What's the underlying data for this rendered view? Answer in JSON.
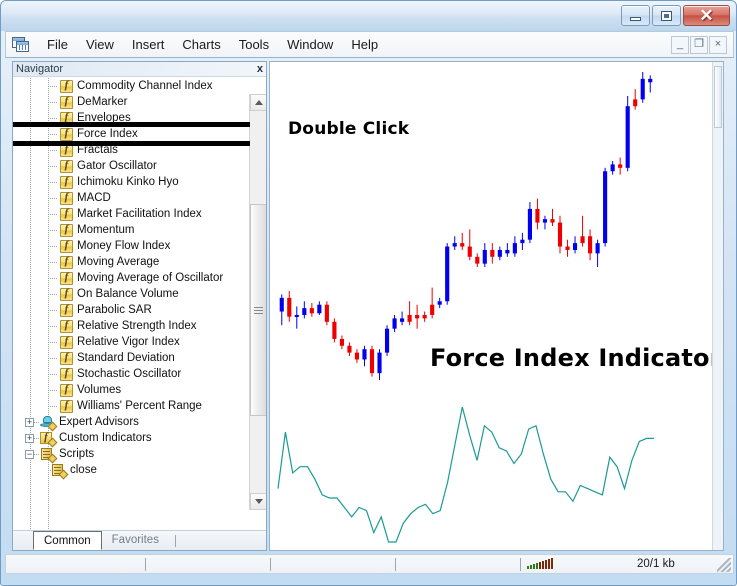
{
  "window": {
    "title": "",
    "buttons": {
      "minimize": "minimize-icon",
      "maximize": "maximize-icon",
      "close": "✕"
    }
  },
  "menu": {
    "app_icon": "metatrader-icon",
    "items": [
      "File",
      "View",
      "Insert",
      "Charts",
      "Tools",
      "Window",
      "Help"
    ],
    "mdi_buttons": [
      "_",
      "❐",
      "×"
    ]
  },
  "navigator": {
    "title": "Navigator",
    "close_label": "x",
    "tree": [
      {
        "label": "Commodity Channel Index",
        "icon": "indicator-f-icon",
        "level": 3,
        "type": "leaf"
      },
      {
        "label": "DeMarker",
        "icon": "indicator-f-icon",
        "level": 3,
        "type": "leaf"
      },
      {
        "label": "Envelopes",
        "icon": "indicator-f-icon",
        "level": 3,
        "type": "leaf"
      },
      {
        "label": "Force Index",
        "icon": "indicator-f-icon",
        "level": 3,
        "type": "leaf",
        "selected": true
      },
      {
        "label": "Fractals",
        "icon": "indicator-f-icon",
        "level": 3,
        "type": "leaf"
      },
      {
        "label": "Gator Oscillator",
        "icon": "indicator-f-icon",
        "level": 3,
        "type": "leaf"
      },
      {
        "label": "Ichimoku Kinko Hyo",
        "icon": "indicator-f-icon",
        "level": 3,
        "type": "leaf"
      },
      {
        "label": "MACD",
        "icon": "indicator-f-icon",
        "level": 3,
        "type": "leaf"
      },
      {
        "label": "Market Facilitation Index",
        "icon": "indicator-f-icon",
        "level": 3,
        "type": "leaf"
      },
      {
        "label": "Momentum",
        "icon": "indicator-f-icon",
        "level": 3,
        "type": "leaf"
      },
      {
        "label": "Money Flow Index",
        "icon": "indicator-f-icon",
        "level": 3,
        "type": "leaf"
      },
      {
        "label": "Moving Average",
        "icon": "indicator-f-icon",
        "level": 3,
        "type": "leaf"
      },
      {
        "label": "Moving Average of Oscillator",
        "icon": "indicator-f-icon",
        "level": 3,
        "type": "leaf"
      },
      {
        "label": "On Balance Volume",
        "icon": "indicator-f-icon",
        "level": 3,
        "type": "leaf"
      },
      {
        "label": "Parabolic SAR",
        "icon": "indicator-f-icon",
        "level": 3,
        "type": "leaf"
      },
      {
        "label": "Relative Strength Index",
        "icon": "indicator-f-icon",
        "level": 3,
        "type": "leaf"
      },
      {
        "label": "Relative Vigor Index",
        "icon": "indicator-f-icon",
        "level": 3,
        "type": "leaf"
      },
      {
        "label": "Standard Deviation",
        "icon": "indicator-f-icon",
        "level": 3,
        "type": "leaf"
      },
      {
        "label": "Stochastic Oscillator",
        "icon": "indicator-f-icon",
        "level": 3,
        "type": "leaf"
      },
      {
        "label": "Volumes",
        "icon": "indicator-f-icon",
        "level": 3,
        "type": "leaf"
      },
      {
        "label": "Williams' Percent Range",
        "icon": "indicator-f-icon",
        "level": 3,
        "type": "leaf"
      },
      {
        "label": "Expert Advisors",
        "icon": "expert-advisor-icon",
        "level": 1,
        "type": "group",
        "expander": "+"
      },
      {
        "label": "Custom Indicators",
        "icon": "custom-indicator-icon",
        "level": 1,
        "type": "group",
        "expander": "+"
      },
      {
        "label": "Scripts",
        "icon": "script-icon",
        "level": 1,
        "type": "group",
        "expander": "−"
      },
      {
        "label": "close",
        "icon": "script-icon",
        "level": 2,
        "type": "leaf"
      }
    ],
    "tabs": [
      {
        "label": "Common",
        "active": true
      },
      {
        "label": "Favorites",
        "active": false
      }
    ],
    "scrollbar": {
      "up_icon": "scroll-up-arrow-icon",
      "down_icon": "scroll-down-arrow-icon",
      "thumb_icon": "scroll-thumb-grip-icon"
    }
  },
  "chart": {
    "annotations": [
      {
        "id": "double-click",
        "text": "Double Click"
      },
      {
        "id": "force-index-indicator",
        "text": "Force Index Indicator"
      }
    ],
    "colors": {
      "bull_candle": "#0000ee",
      "bear_candle": "#ee0000",
      "indicator_line": "#1a9a96"
    }
  },
  "status_bar": {
    "signal_icon": "signal-strength-icon",
    "traffic": "20/1 kb",
    "resize_grip": "resize-grip-icon"
  },
  "chart_data": {
    "type": "line",
    "title": "Force Index Indicator",
    "xlabel": "",
    "ylabel": "",
    "panes": [
      {
        "name": "price",
        "type": "candlestick",
        "candles": [
          {
            "o": 52,
            "h": 62,
            "l": 44,
            "c": 60,
            "dir": "up"
          },
          {
            "o": 60,
            "h": 64,
            "l": 46,
            "c": 49,
            "dir": "down"
          },
          {
            "o": 49,
            "h": 55,
            "l": 42,
            "c": 50,
            "dir": "up"
          },
          {
            "o": 50,
            "h": 58,
            "l": 48,
            "c": 54,
            "dir": "up"
          },
          {
            "o": 54,
            "h": 57,
            "l": 49,
            "c": 51,
            "dir": "down"
          },
          {
            "o": 51,
            "h": 58,
            "l": 50,
            "c": 56,
            "dir": "up"
          },
          {
            "o": 56,
            "h": 58,
            "l": 44,
            "c": 46,
            "dir": "down"
          },
          {
            "o": 46,
            "h": 48,
            "l": 34,
            "c": 36,
            "dir": "down"
          },
          {
            "o": 36,
            "h": 38,
            "l": 30,
            "c": 32,
            "dir": "down"
          },
          {
            "o": 32,
            "h": 34,
            "l": 26,
            "c": 28,
            "dir": "down"
          },
          {
            "o": 28,
            "h": 30,
            "l": 22,
            "c": 24,
            "dir": "down"
          },
          {
            "o": 24,
            "h": 32,
            "l": 20,
            "c": 30,
            "dir": "up"
          },
          {
            "o": 30,
            "h": 32,
            "l": 14,
            "c": 16,
            "dir": "down"
          },
          {
            "o": 16,
            "h": 30,
            "l": 12,
            "c": 28,
            "dir": "up"
          },
          {
            "o": 28,
            "h": 44,
            "l": 26,
            "c": 42,
            "dir": "up"
          },
          {
            "o": 42,
            "h": 50,
            "l": 40,
            "c": 48,
            "dir": "up"
          },
          {
            "o": 48,
            "h": 52,
            "l": 44,
            "c": 46,
            "dir": "up"
          },
          {
            "o": 46,
            "h": 58,
            "l": 44,
            "c": 50,
            "dir": "down"
          },
          {
            "o": 50,
            "h": 56,
            "l": 42,
            "c": 48,
            "dir": "down"
          },
          {
            "o": 48,
            "h": 52,
            "l": 46,
            "c": 50,
            "dir": "down"
          },
          {
            "o": 50,
            "h": 66,
            "l": 48,
            "c": 56,
            "dir": "down"
          },
          {
            "o": 56,
            "h": 60,
            "l": 54,
            "c": 58,
            "dir": "up"
          },
          {
            "o": 58,
            "h": 92,
            "l": 56,
            "c": 90,
            "dir": "up"
          },
          {
            "o": 90,
            "h": 96,
            "l": 88,
            "c": 92,
            "dir": "up"
          },
          {
            "o": 92,
            "h": 98,
            "l": 88,
            "c": 90,
            "dir": "down"
          },
          {
            "o": 90,
            "h": 100,
            "l": 82,
            "c": 84,
            "dir": "down"
          },
          {
            "o": 84,
            "h": 86,
            "l": 78,
            "c": 80,
            "dir": "down"
          },
          {
            "o": 80,
            "h": 92,
            "l": 78,
            "c": 88,
            "dir": "up"
          },
          {
            "o": 88,
            "h": 92,
            "l": 80,
            "c": 84,
            "dir": "down"
          },
          {
            "o": 84,
            "h": 90,
            "l": 82,
            "c": 88,
            "dir": "up"
          },
          {
            "o": 88,
            "h": 92,
            "l": 84,
            "c": 86,
            "dir": "up"
          },
          {
            "o": 86,
            "h": 96,
            "l": 84,
            "c": 92,
            "dir": "up"
          },
          {
            "o": 92,
            "h": 98,
            "l": 88,
            "c": 94,
            "dir": "up"
          },
          {
            "o": 94,
            "h": 116,
            "l": 92,
            "c": 112,
            "dir": "up"
          },
          {
            "o": 112,
            "h": 118,
            "l": 100,
            "c": 104,
            "dir": "down"
          },
          {
            "o": 104,
            "h": 108,
            "l": 100,
            "c": 106,
            "dir": "up"
          },
          {
            "o": 106,
            "h": 112,
            "l": 102,
            "c": 104,
            "dir": "down"
          },
          {
            "o": 104,
            "h": 108,
            "l": 86,
            "c": 90,
            "dir": "down"
          },
          {
            "o": 90,
            "h": 94,
            "l": 84,
            "c": 88,
            "dir": "down"
          },
          {
            "o": 88,
            "h": 96,
            "l": 86,
            "c": 92,
            "dir": "up"
          },
          {
            "o": 92,
            "h": 108,
            "l": 90,
            "c": 96,
            "dir": "down"
          },
          {
            "o": 96,
            "h": 100,
            "l": 82,
            "c": 86,
            "dir": "down"
          },
          {
            "o": 86,
            "h": 94,
            "l": 78,
            "c": 92,
            "dir": "up"
          },
          {
            "o": 92,
            "h": 136,
            "l": 90,
            "c": 134,
            "dir": "up"
          },
          {
            "o": 134,
            "h": 140,
            "l": 132,
            "c": 138,
            "dir": "up"
          },
          {
            "o": 138,
            "h": 142,
            "l": 132,
            "c": 136,
            "dir": "down"
          },
          {
            "o": 136,
            "h": 178,
            "l": 134,
            "c": 172,
            "dir": "up"
          },
          {
            "o": 172,
            "h": 182,
            "l": 170,
            "c": 176,
            "dir": "down"
          },
          {
            "o": 176,
            "h": 192,
            "l": 174,
            "c": 188,
            "dir": "up"
          },
          {
            "o": 188,
            "h": 190,
            "l": 180,
            "c": 186,
            "dir": "up"
          }
        ]
      },
      {
        "name": "force_index",
        "type": "line",
        "color": "#1a9a96",
        "values": [
          52,
          88,
          62,
          66,
          66,
          58,
          48,
          46,
          46,
          40,
          34,
          40,
          38,
          24,
          34,
          18,
          18,
          30,
          36,
          40,
          42,
          36,
          38,
          56,
          80,
          104,
          86,
          70,
          92,
          88,
          78,
          76,
          68,
          74,
          90,
          92,
          74,
          58,
          50,
          50,
          44,
          54,
          52,
          50,
          48,
          72,
          66,
          52,
          70,
          82,
          84,
          84
        ]
      }
    ]
  }
}
